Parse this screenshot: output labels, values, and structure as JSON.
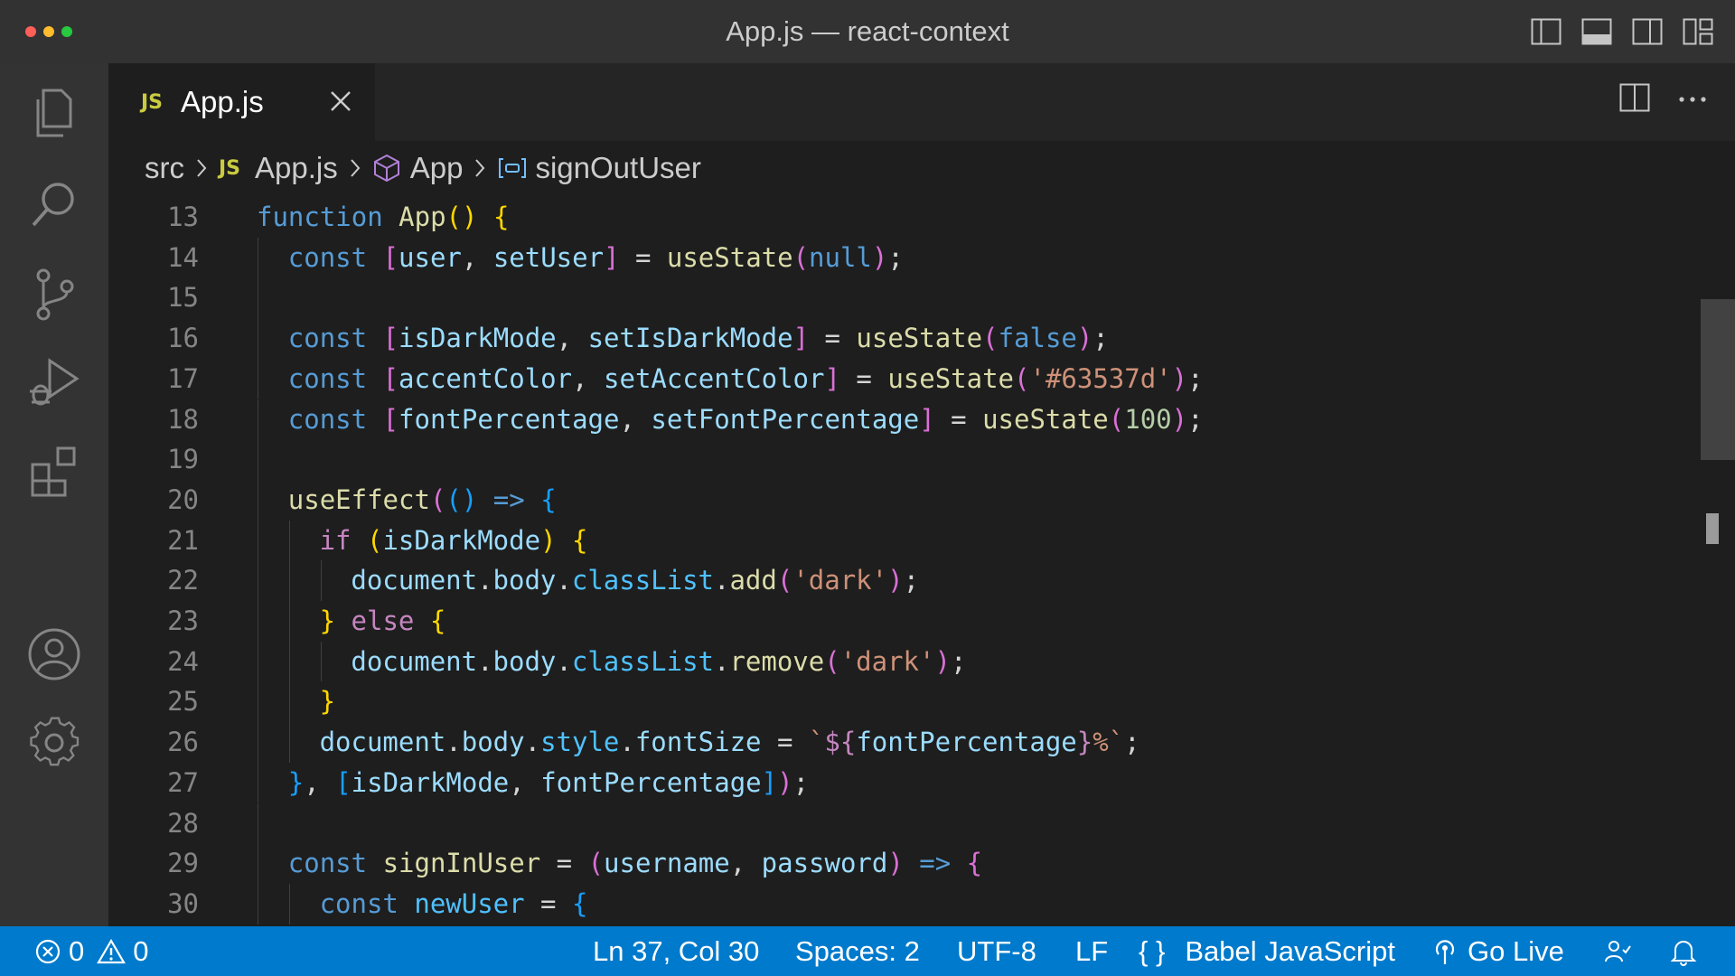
{
  "window": {
    "title": "App.js — react-context"
  },
  "tab": {
    "badge": "JS",
    "label": "App.js"
  },
  "breadcrumb": {
    "folder": "src",
    "file_badge": "JS",
    "file": "App.js",
    "component": "App",
    "symbol": "signOutUser"
  },
  "editor": {
    "lines": [
      {
        "num": "13",
        "indent": 0,
        "tokens": [
          [
            "kw",
            "function"
          ],
          [
            "p",
            " "
          ],
          [
            "fn",
            "App"
          ],
          [
            "b1",
            "()"
          ],
          [
            "p",
            " "
          ],
          [
            "b1",
            "{"
          ]
        ]
      },
      {
        "num": "14",
        "indent": 1,
        "tokens": [
          [
            "kw",
            "const"
          ],
          [
            "p",
            " "
          ],
          [
            "b2",
            "["
          ],
          [
            "var",
            "user"
          ],
          [
            "p",
            ", "
          ],
          [
            "var",
            "setUser"
          ],
          [
            "b2",
            "]"
          ],
          [
            "p",
            " = "
          ],
          [
            "fn",
            "useState"
          ],
          [
            "b2",
            "("
          ],
          [
            "kw",
            "null"
          ],
          [
            "b2",
            ")"
          ],
          [
            "p",
            ";"
          ]
        ]
      },
      {
        "num": "15",
        "indent": 1,
        "tokens": []
      },
      {
        "num": "16",
        "indent": 1,
        "tokens": [
          [
            "kw",
            "const"
          ],
          [
            "p",
            " "
          ],
          [
            "b2",
            "["
          ],
          [
            "var",
            "isDarkMode"
          ],
          [
            "p",
            ", "
          ],
          [
            "var",
            "setIsDarkMode"
          ],
          [
            "b2",
            "]"
          ],
          [
            "p",
            " = "
          ],
          [
            "fn",
            "useState"
          ],
          [
            "b2",
            "("
          ],
          [
            "kw",
            "false"
          ],
          [
            "b2",
            ")"
          ],
          [
            "p",
            ";"
          ]
        ]
      },
      {
        "num": "17",
        "indent": 1,
        "tokens": [
          [
            "kw",
            "const"
          ],
          [
            "p",
            " "
          ],
          [
            "b2",
            "["
          ],
          [
            "var",
            "accentColor"
          ],
          [
            "p",
            ", "
          ],
          [
            "var",
            "setAccentColor"
          ],
          [
            "b2",
            "]"
          ],
          [
            "p",
            " = "
          ],
          [
            "fn",
            "useState"
          ],
          [
            "b2",
            "("
          ],
          [
            "str",
            "'#63537d'"
          ],
          [
            "b2",
            ")"
          ],
          [
            "p",
            ";"
          ]
        ]
      },
      {
        "num": "18",
        "indent": 1,
        "tokens": [
          [
            "kw",
            "const"
          ],
          [
            "p",
            " "
          ],
          [
            "b2",
            "["
          ],
          [
            "var",
            "fontPercentage"
          ],
          [
            "p",
            ", "
          ],
          [
            "var",
            "setFontPercentage"
          ],
          [
            "b2",
            "]"
          ],
          [
            "p",
            " = "
          ],
          [
            "fn",
            "useState"
          ],
          [
            "b2",
            "("
          ],
          [
            "num",
            "100"
          ],
          [
            "b2",
            ")"
          ],
          [
            "p",
            ";"
          ]
        ]
      },
      {
        "num": "19",
        "indent": 1,
        "tokens": []
      },
      {
        "num": "20",
        "indent": 1,
        "tokens": [
          [
            "fn",
            "useEffect"
          ],
          [
            "b2",
            "("
          ],
          [
            "b3",
            "()"
          ],
          [
            "p",
            " "
          ],
          [
            "kw",
            "=>"
          ],
          [
            "p",
            " "
          ],
          [
            "b3",
            "{"
          ]
        ]
      },
      {
        "num": "21",
        "indent": 2,
        "tokens": [
          [
            "ctl",
            "if"
          ],
          [
            "p",
            " "
          ],
          [
            "b1",
            "("
          ],
          [
            "var",
            "isDarkMode"
          ],
          [
            "b1",
            ")"
          ],
          [
            "p",
            " "
          ],
          [
            "b1",
            "{"
          ]
        ]
      },
      {
        "num": "22",
        "indent": 3,
        "tokens": [
          [
            "var",
            "document"
          ],
          [
            "p",
            "."
          ],
          [
            "var",
            "body"
          ],
          [
            "p",
            "."
          ],
          [
            "prop",
            "classList"
          ],
          [
            "p",
            "."
          ],
          [
            "fn",
            "add"
          ],
          [
            "b2",
            "("
          ],
          [
            "str",
            "'dark'"
          ],
          [
            "b2",
            ")"
          ],
          [
            "p",
            ";"
          ]
        ]
      },
      {
        "num": "23",
        "indent": 2,
        "tokens": [
          [
            "b1",
            "}"
          ],
          [
            "p",
            " "
          ],
          [
            "ctl",
            "else"
          ],
          [
            "p",
            " "
          ],
          [
            "b1",
            "{"
          ]
        ]
      },
      {
        "num": "24",
        "indent": 3,
        "tokens": [
          [
            "var",
            "document"
          ],
          [
            "p",
            "."
          ],
          [
            "var",
            "body"
          ],
          [
            "p",
            "."
          ],
          [
            "prop",
            "classList"
          ],
          [
            "p",
            "."
          ],
          [
            "fn",
            "remove"
          ],
          [
            "b2",
            "("
          ],
          [
            "str",
            "'dark'"
          ],
          [
            "b2",
            ")"
          ],
          [
            "p",
            ";"
          ]
        ]
      },
      {
        "num": "25",
        "indent": 2,
        "tokens": [
          [
            "b1",
            "}"
          ]
        ]
      },
      {
        "num": "26",
        "indent": 2,
        "tokens": [
          [
            "var",
            "document"
          ],
          [
            "p",
            "."
          ],
          [
            "var",
            "body"
          ],
          [
            "p",
            "."
          ],
          [
            "prop",
            "style"
          ],
          [
            "p",
            "."
          ],
          [
            "var",
            "fontSize"
          ],
          [
            "p",
            " = "
          ],
          [
            "str",
            "`"
          ],
          [
            "ctl",
            "${"
          ],
          [
            "var",
            "fontPercentage"
          ],
          [
            "ctl",
            "}"
          ],
          [
            "str",
            "%`"
          ],
          [
            "p",
            ";"
          ]
        ]
      },
      {
        "num": "27",
        "indent": 1,
        "tokens": [
          [
            "b3",
            "}"
          ],
          [
            "p",
            ", "
          ],
          [
            "b3",
            "["
          ],
          [
            "var",
            "isDarkMode"
          ],
          [
            "p",
            ", "
          ],
          [
            "var",
            "fontPercentage"
          ],
          [
            "b3",
            "]"
          ],
          [
            "b2",
            ")"
          ],
          [
            "p",
            ";"
          ]
        ]
      },
      {
        "num": "28",
        "indent": 1,
        "tokens": []
      },
      {
        "num": "29",
        "indent": 1,
        "tokens": [
          [
            "kw",
            "const"
          ],
          [
            "p",
            " "
          ],
          [
            "fn",
            "signInUser"
          ],
          [
            "p",
            " = "
          ],
          [
            "b2",
            "("
          ],
          [
            "var",
            "username"
          ],
          [
            "p",
            ", "
          ],
          [
            "var",
            "password"
          ],
          [
            "b2",
            ")"
          ],
          [
            "p",
            " "
          ],
          [
            "kw",
            "=>"
          ],
          [
            "p",
            " "
          ],
          [
            "b2",
            "{"
          ]
        ]
      },
      {
        "num": "30",
        "indent": 2,
        "tokens": [
          [
            "kw",
            "const"
          ],
          [
            "p",
            " "
          ],
          [
            "cst",
            "newUser"
          ],
          [
            "p",
            " = "
          ],
          [
            "b3",
            "{"
          ]
        ]
      }
    ]
  },
  "statusbar": {
    "errors": "0",
    "warnings": "0",
    "cursor": "Ln 37, Col 30",
    "spaces": "Spaces: 2",
    "encoding": "UTF-8",
    "eol": "LF",
    "language_icon": "{ }",
    "language": "Babel JavaScript",
    "golive": "Go Live"
  },
  "colors": {
    "kw": "#569cd6",
    "ctl": "#c586c0",
    "fn": "#dcdcaa",
    "var": "#9cdcfe",
    "prop": "#4fc1ff",
    "cst": "#4fc1ff",
    "str": "#ce9178",
    "num": "#b5cea8",
    "p": "#d4d4d4",
    "b1": "#ffd700",
    "b2": "#da70d6",
    "b3": "#179fff",
    "statusbar": "#007acc"
  },
  "icons": {
    "activity": [
      "explorer-icon",
      "search-icon",
      "source-control-icon",
      "run-debug-icon",
      "extensions-icon",
      "accounts-icon",
      "manage-gear-icon"
    ]
  }
}
